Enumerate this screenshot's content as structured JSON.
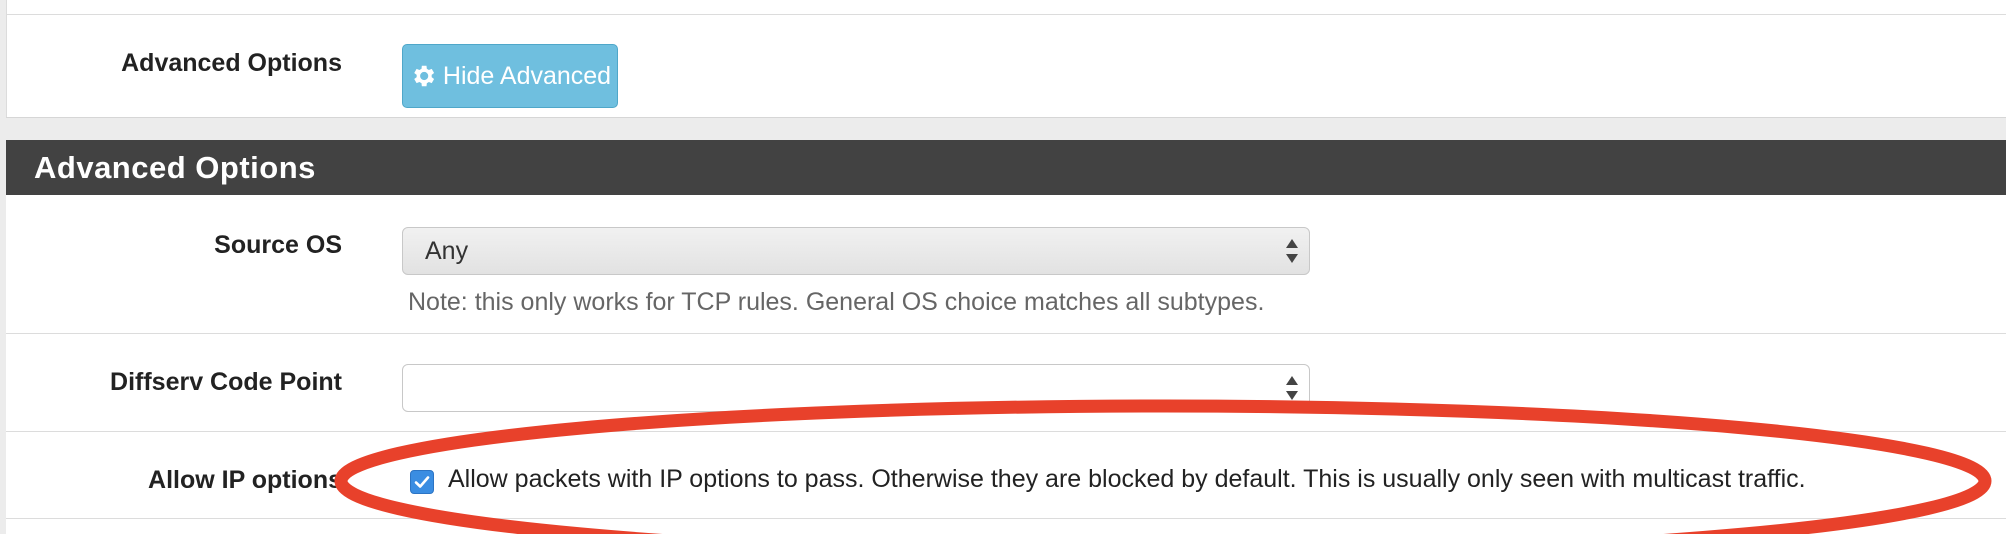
{
  "top_row": {
    "label": "Advanced Options",
    "button_label": "Hide Advanced",
    "button_icon": "gear-icon"
  },
  "advanced_section": {
    "title": "Advanced Options",
    "source_os": {
      "label": "Source OS",
      "selected": "Any",
      "note": "Note: this only works for TCP rules. General OS choice matches all subtypes."
    },
    "diffserv": {
      "label": "Diffserv Code Point",
      "selected": ""
    },
    "allow_ip_options": {
      "label": "Allow IP options",
      "checked": true,
      "description": "Allow packets with IP options to pass. Otherwise they are blocked by default. This is usually only seen with multicast traffic."
    }
  },
  "colors": {
    "header_bg": "#424242",
    "button_bg": "#6fbfdf",
    "checkbox_bg": "#3a8de2",
    "annotation_red": "#e8412b"
  }
}
